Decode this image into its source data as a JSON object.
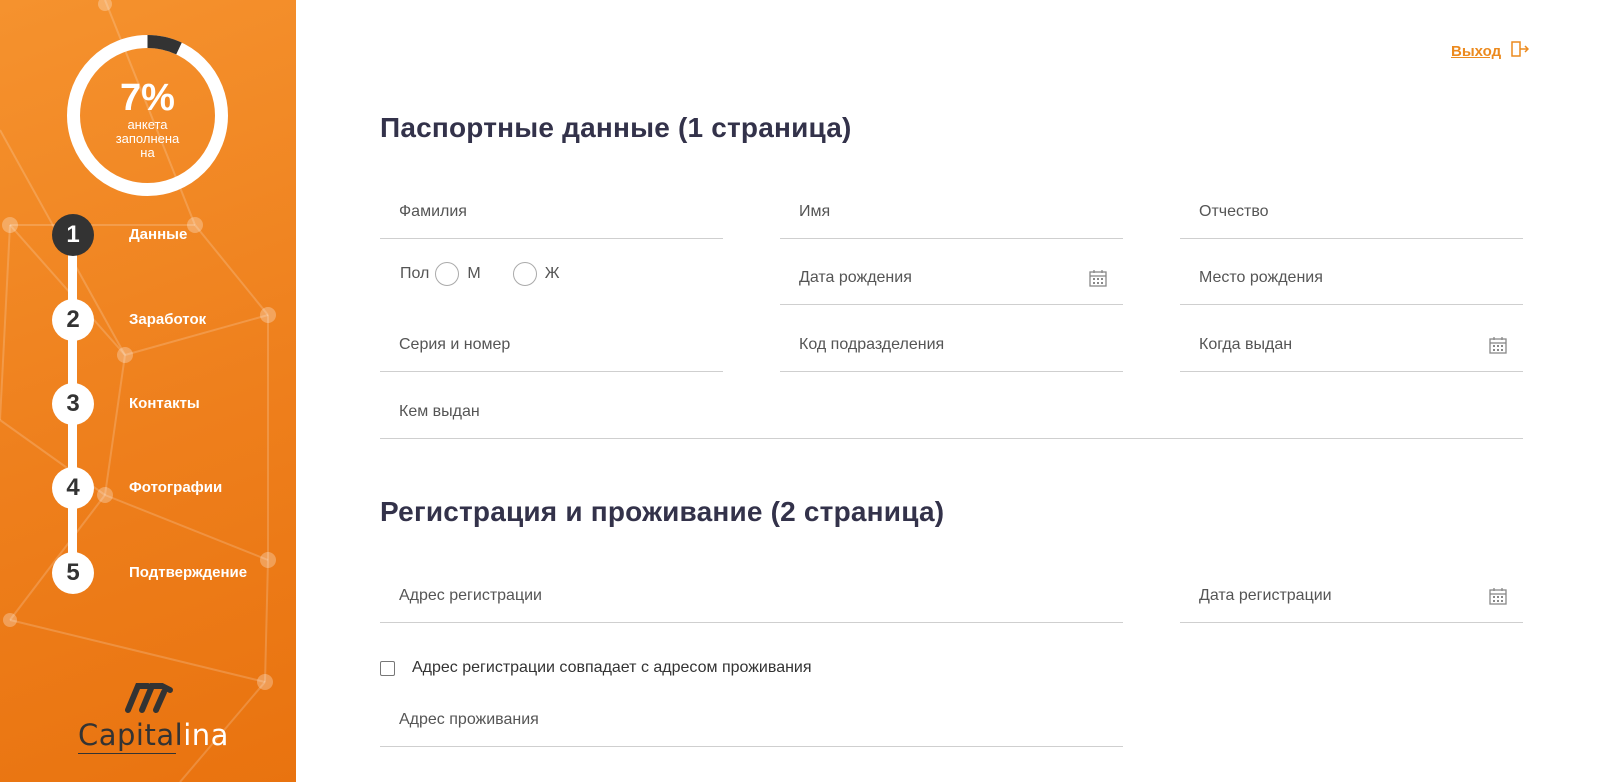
{
  "colors": {
    "accent": "#ee7f1c",
    "dark": "#333333",
    "heading": "#33324a",
    "link": "#ec8a1e"
  },
  "sidebar": {
    "progress": {
      "value_percent": 7,
      "value_text": "7%",
      "label": "анкета заполнена на"
    },
    "steps": [
      {
        "number": "1",
        "label": "Данные",
        "active": true
      },
      {
        "number": "2",
        "label": "Заработок",
        "active": false
      },
      {
        "number": "3",
        "label": "Контакты",
        "active": false
      },
      {
        "number": "4",
        "label": "Фотографии",
        "active": false
      },
      {
        "number": "5",
        "label": "Подтверждение",
        "active": false
      }
    ],
    "logo": {
      "word_main": "Capital",
      "word_tail": "ina"
    }
  },
  "header": {
    "exit_label": "Выход",
    "exit_icon": "exit-door-icon"
  },
  "passport": {
    "title": "Паспортные данные (1 страница)",
    "fields": {
      "surname": "Фамилия",
      "name": "Имя",
      "patronymic": "Отчество",
      "gender_label": "Пол",
      "gender_male": "М",
      "gender_female": "Ж",
      "birth_date": "Дата рождения",
      "birth_place": "Место рождения",
      "series_number": "Серия и номер",
      "department_code": "Код подразделения",
      "issue_date": "Когда выдан",
      "issued_by": "Кем выдан"
    }
  },
  "registration": {
    "title": "Регистрация и проживание (2 страница)",
    "fields": {
      "reg_address": "Адрес регистрации",
      "reg_date": "Дата регистрации",
      "same_address_checkbox": "Адрес регистрации совпадает с адресом проживания",
      "living_address": "Адрес проживания"
    }
  }
}
